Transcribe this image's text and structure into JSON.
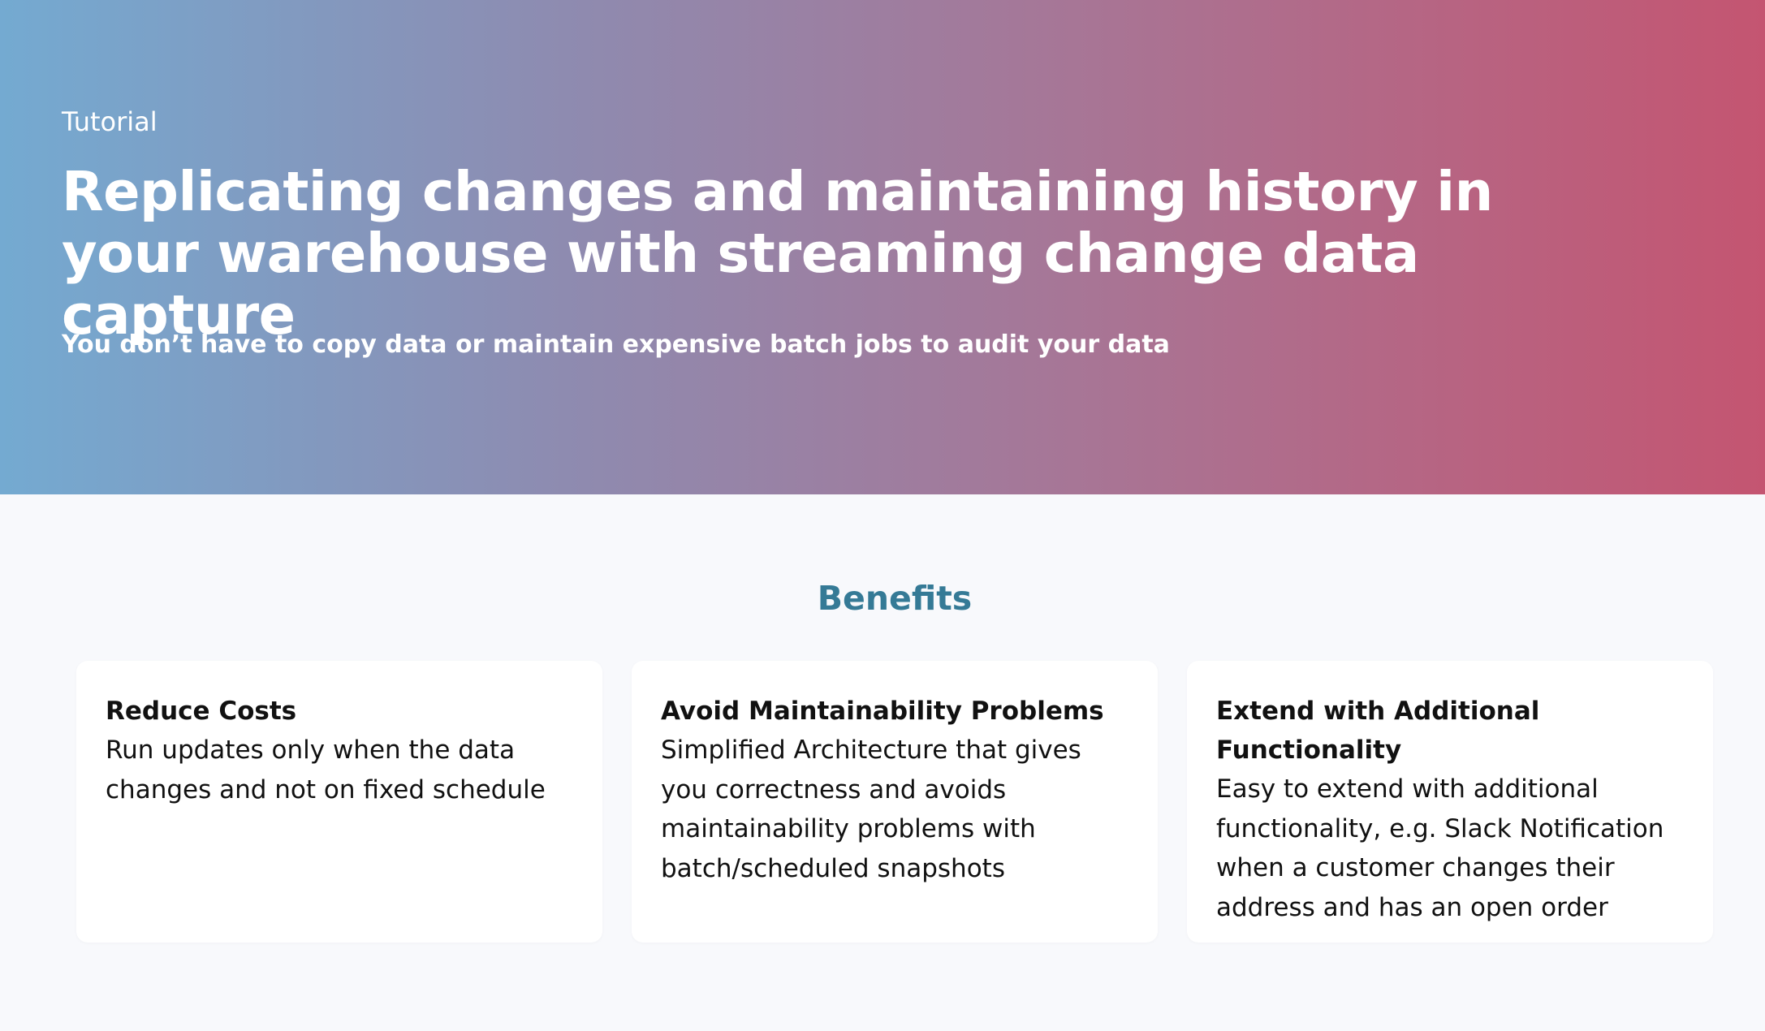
{
  "hero": {
    "eyebrow": "Tutorial",
    "title": "Replicating changes and maintaining history in your warehouse with streaming change data capture",
    "subtitle": "You don’t have to copy data or maintain expensive batch jobs to audit your data",
    "gradient_colors": [
      "#74aad1",
      "#8e8bb0",
      "#a87595",
      "#c45571"
    ]
  },
  "benefits": {
    "heading": "Benefits",
    "heading_color": "#357a96",
    "cards": [
      {
        "title": "Reduce Costs",
        "text": "Run updates only when the data changes and not on fixed schedule"
      },
      {
        "title": "Avoid Maintainability Problems",
        "text": "Simplified Architecture that gives you correctness and avoids maintainability problems with batch/scheduled snapshots"
      },
      {
        "title": "Extend with Additional Functionality",
        "text": "Easy to extend with additional functionality, e.g. Slack Notification when a customer changes their address and has an open order"
      }
    ]
  }
}
